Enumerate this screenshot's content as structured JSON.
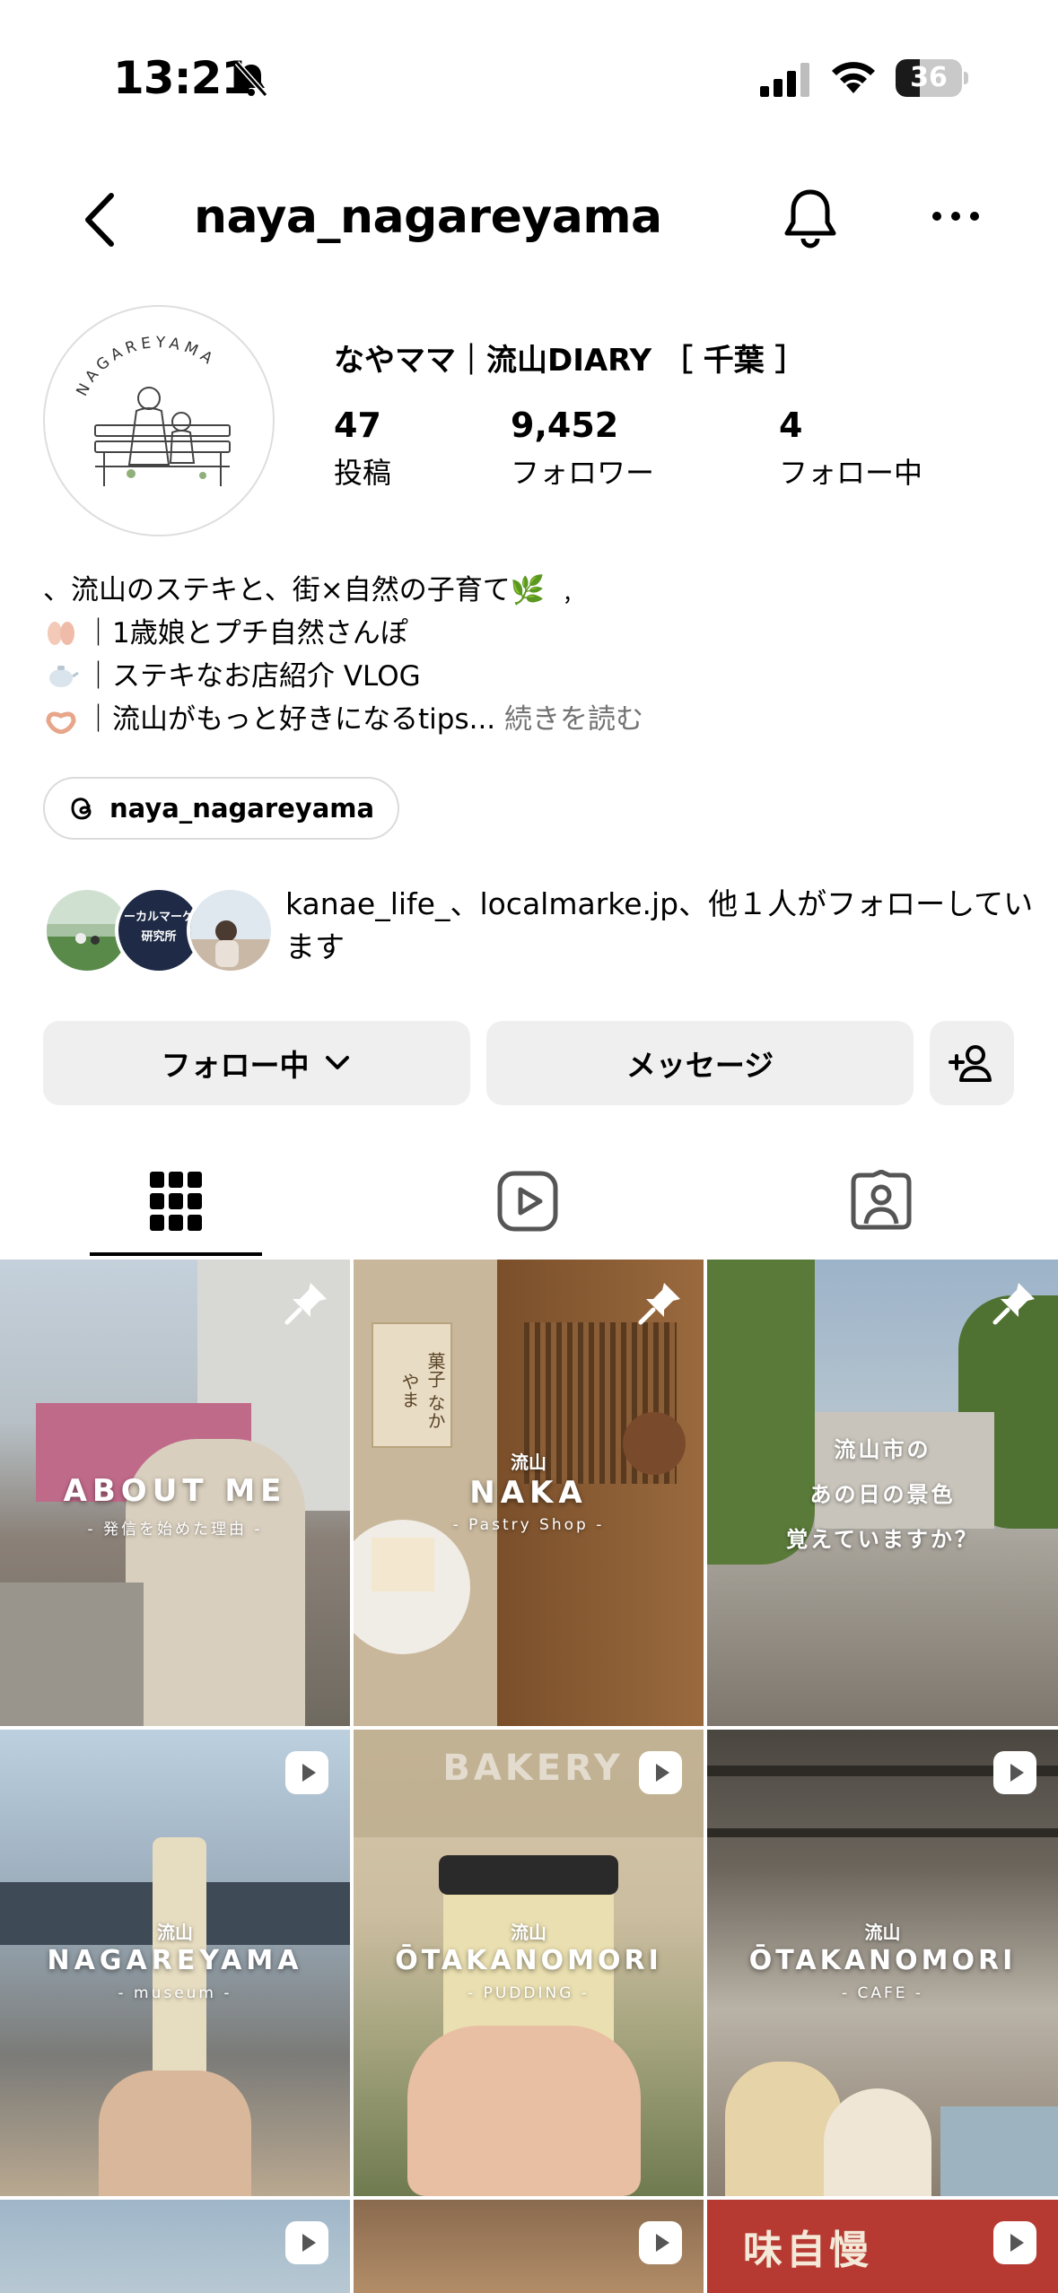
{
  "status_bar": {
    "time": "13:21",
    "battery": "36",
    "battery_level": 0.36
  },
  "header": {
    "username": "naya_nagareyama"
  },
  "profile": {
    "avatar_text": "NAGAREYAMA",
    "display_name": "なやママ｜流山DIARY ［ 千葉 ］",
    "stats": [
      {
        "value": "47",
        "label": "投稿"
      },
      {
        "value": "9,452",
        "label": "フォロワー"
      },
      {
        "value": "4",
        "label": "フォロー中"
      }
    ],
    "bio": {
      "line1": "、流山のステキと、街×自然の子育て🌿 ﹐",
      "line2_text": "｜1歳娘とプチ自然さんぽ",
      "line3_text": "｜ステキなお店紹介 VLOG",
      "line4_text": "｜流山がもっと好きになるtips...",
      "more": "続きを読む"
    },
    "threads_handle": "naya_nagareyama",
    "followed_by": {
      "text": "kanae_life_、localmarke.jp、他１人がフォローしています",
      "avatar2_text": "ーカルマーケ研究所"
    }
  },
  "actions": {
    "following": "フォロー中",
    "message": "メッセージ"
  },
  "grid": {
    "tiles": [
      {
        "title": "ABOUT ME",
        "sub": "- 発信を始めた理由 -"
      },
      {
        "small": "流山",
        "title": "NAKA",
        "sub": "- Pastry Shop -",
        "sign": "菓子 なかやま"
      },
      {
        "lines": [
          "流山市の",
          "あの日の景色",
          "覚えていますか？"
        ]
      },
      {
        "small": "流山",
        "title": "NAGAREYAMA",
        "sub": "- museum -"
      },
      {
        "small": "流山",
        "title": "ŌTAKANOMORI",
        "sub": "- PUDDING -",
        "bg_text": "BAKERY"
      },
      {
        "small": "流山",
        "title": "ŌTAKANOMORI",
        "sub": "- CAFE -"
      },
      {},
      {},
      {
        "sign": "味自慢"
      }
    ]
  },
  "colors": {
    "button_bg": "#efefef",
    "muted_text": "#737373",
    "border": "#dbdbdb"
  }
}
